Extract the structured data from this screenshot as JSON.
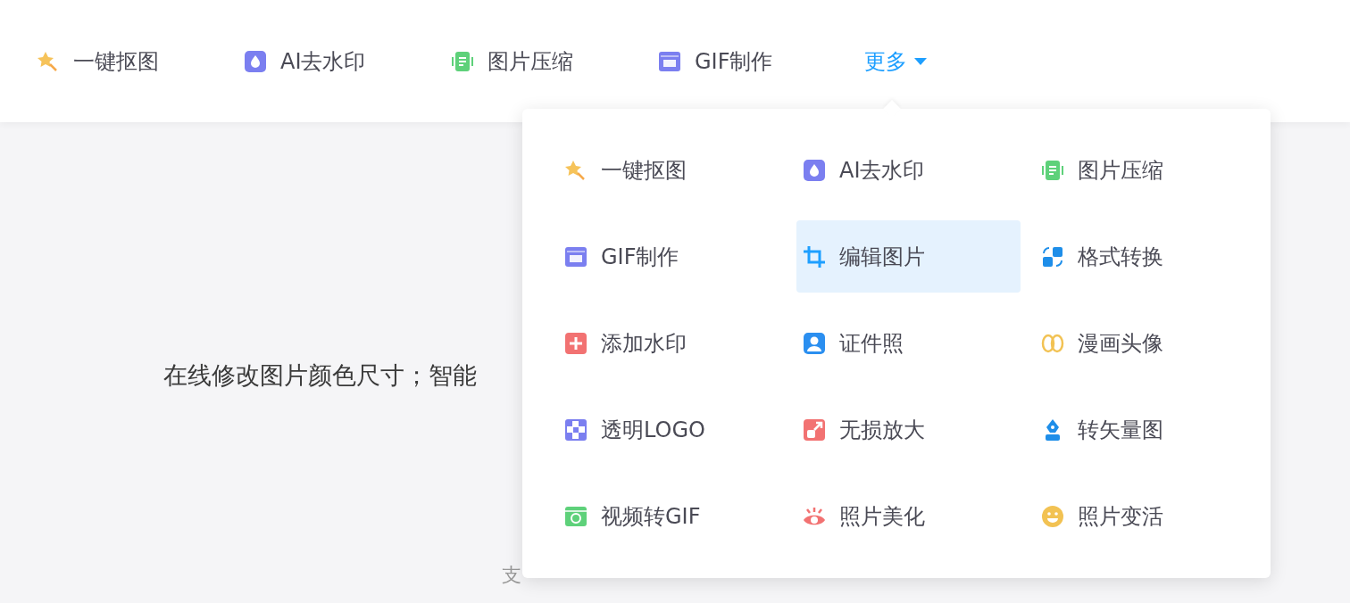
{
  "nav": {
    "items": [
      {
        "label": "一键抠图"
      },
      {
        "label": "AI去水印"
      },
      {
        "label": "图片压缩"
      },
      {
        "label": "GIF制作"
      }
    ],
    "more": {
      "label": "更多",
      "expanded": true
    }
  },
  "hero": {
    "subtitle": "在线修改图片颜色尺寸；智能",
    "hint": "支"
  },
  "menu": {
    "items": [
      {
        "label": "一键抠图",
        "selected": false
      },
      {
        "label": "AI去水印",
        "selected": false
      },
      {
        "label": "图片压缩",
        "selected": false
      },
      {
        "label": "GIF制作",
        "selected": false
      },
      {
        "label": "编辑图片",
        "selected": true
      },
      {
        "label": "格式转换",
        "selected": false
      },
      {
        "label": "添加水印",
        "selected": false
      },
      {
        "label": "证件照",
        "selected": false
      },
      {
        "label": "漫画头像",
        "selected": false
      },
      {
        "label": "透明LOGO",
        "selected": false
      },
      {
        "label": "无损放大",
        "selected": false
      },
      {
        "label": "转矢量图",
        "selected": false
      },
      {
        "label": "视频转GIF",
        "selected": false
      },
      {
        "label": "照片美化",
        "selected": false
      },
      {
        "label": "照片变活",
        "selected": false
      }
    ]
  }
}
